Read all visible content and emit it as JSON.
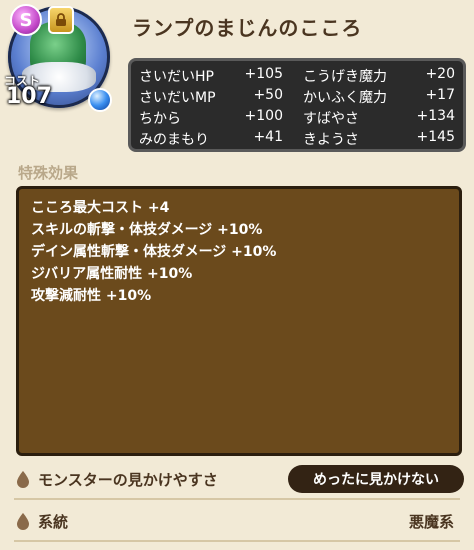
{
  "header": {
    "rank": "S",
    "cost_label": "コスト",
    "cost_value": "107",
    "title": "ランプのまじんのこころ"
  },
  "stats": [
    [
      {
        "label": "さいだいHP",
        "value": "+105"
      },
      {
        "label": "こうげき魔力",
        "value": "+20"
      }
    ],
    [
      {
        "label": "さいだいMP",
        "value": "+50"
      },
      {
        "label": "かいふく魔力",
        "value": "+17"
      }
    ],
    [
      {
        "label": "ちから",
        "value": "+100"
      },
      {
        "label": "すばやさ",
        "value": "+134"
      }
    ],
    [
      {
        "label": "みのまもり",
        "value": "+41"
      },
      {
        "label": "きようさ",
        "value": "+145"
      }
    ]
  ],
  "special_section": {
    "label": "特殊効果",
    "effects": [
      "こころ最大コスト +4",
      "スキルの斬撃・体技ダメージ +10%",
      "デイン属性斬撃・体技ダメージ +10%",
      "ジバリア属性耐性 +10%",
      "攻撃減耐性 +10%"
    ]
  },
  "visibility": {
    "label": "モンスターの見かけやすさ",
    "value": "めったに見かけない"
  },
  "lineage": {
    "label": "系統",
    "value": "悪魔系"
  }
}
